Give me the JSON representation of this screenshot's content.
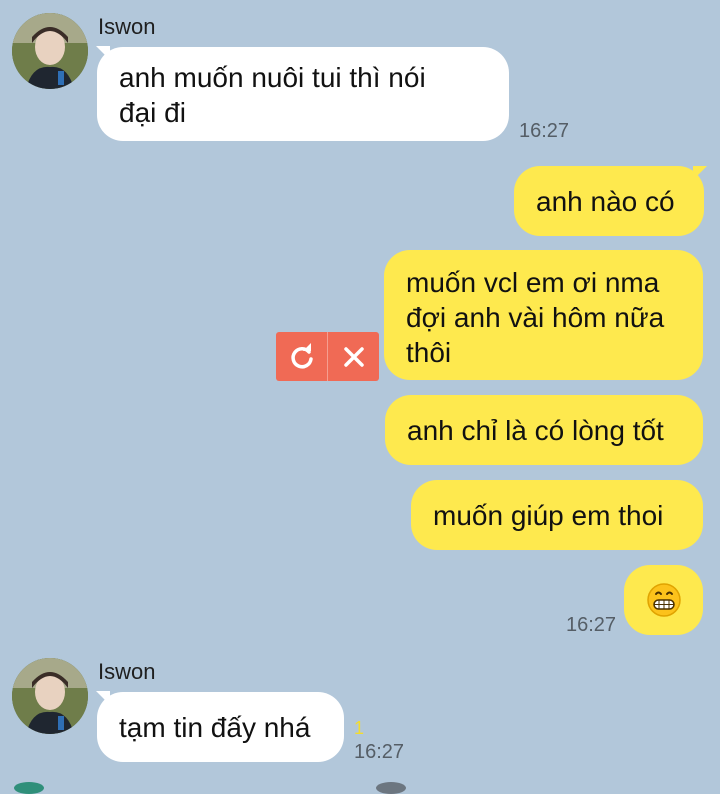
{
  "contact": {
    "name": "Iswon"
  },
  "messages": [
    {
      "id": "m1",
      "from": "contact",
      "text_line1": "anh muốn nuôi tui thì nói",
      "text_line2": "đại đi",
      "time": "16:27"
    },
    {
      "id": "m2",
      "from": "me",
      "text": "anh nào có"
    },
    {
      "id": "m3",
      "from": "me",
      "text_line1": "muốn vcl em ơi nma",
      "text_line2": "đợi anh vài hôm nữa",
      "text_line3": "thôi",
      "status": "failed"
    },
    {
      "id": "m4",
      "from": "me",
      "text": "anh chỉ là có lòng tốt"
    },
    {
      "id": "m5",
      "from": "me",
      "text": "muốn giúp em thoi"
    },
    {
      "id": "m6",
      "from": "me",
      "emoji": "grinning-face",
      "time": "16:27"
    },
    {
      "id": "m7",
      "from": "contact",
      "text": "tạm tin đấy nhá",
      "unread_count": "1",
      "time": "16:27"
    }
  ],
  "colors": {
    "background": "#b2c7da",
    "incoming": "#ffffff",
    "outgoing": "#fee94e",
    "failed": "#f06a55"
  },
  "icons": {
    "retry": "retry-icon",
    "delete": "close-icon",
    "emoji": "grinning-face-icon"
  }
}
